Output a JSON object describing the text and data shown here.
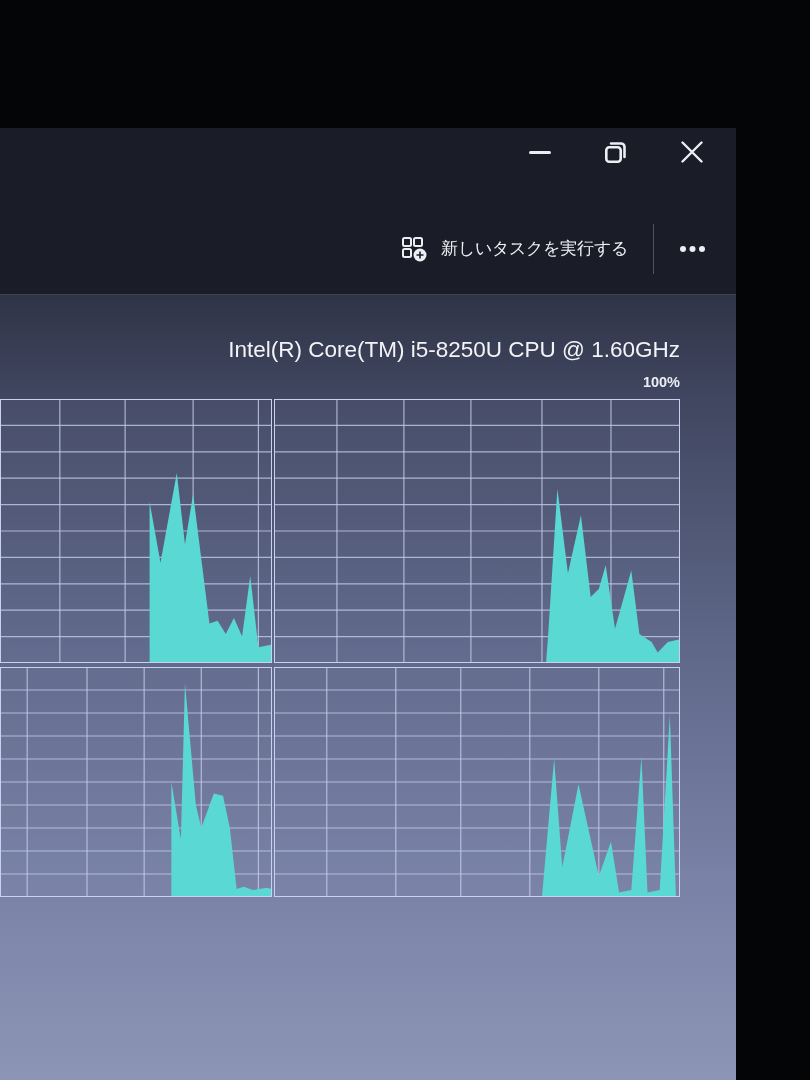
{
  "window": {
    "controls": [
      {
        "kind": "minimize"
      },
      {
        "kind": "restore"
      },
      {
        "kind": "close"
      }
    ]
  },
  "toolbar": {
    "run_new_task": {
      "label": "新しいタスクを実行する"
    }
  },
  "performance": {
    "cpu_name": "Intel(R) Core(TM) i5-8250U CPU @ 1.60GHz",
    "scale_max": "100%"
  }
}
